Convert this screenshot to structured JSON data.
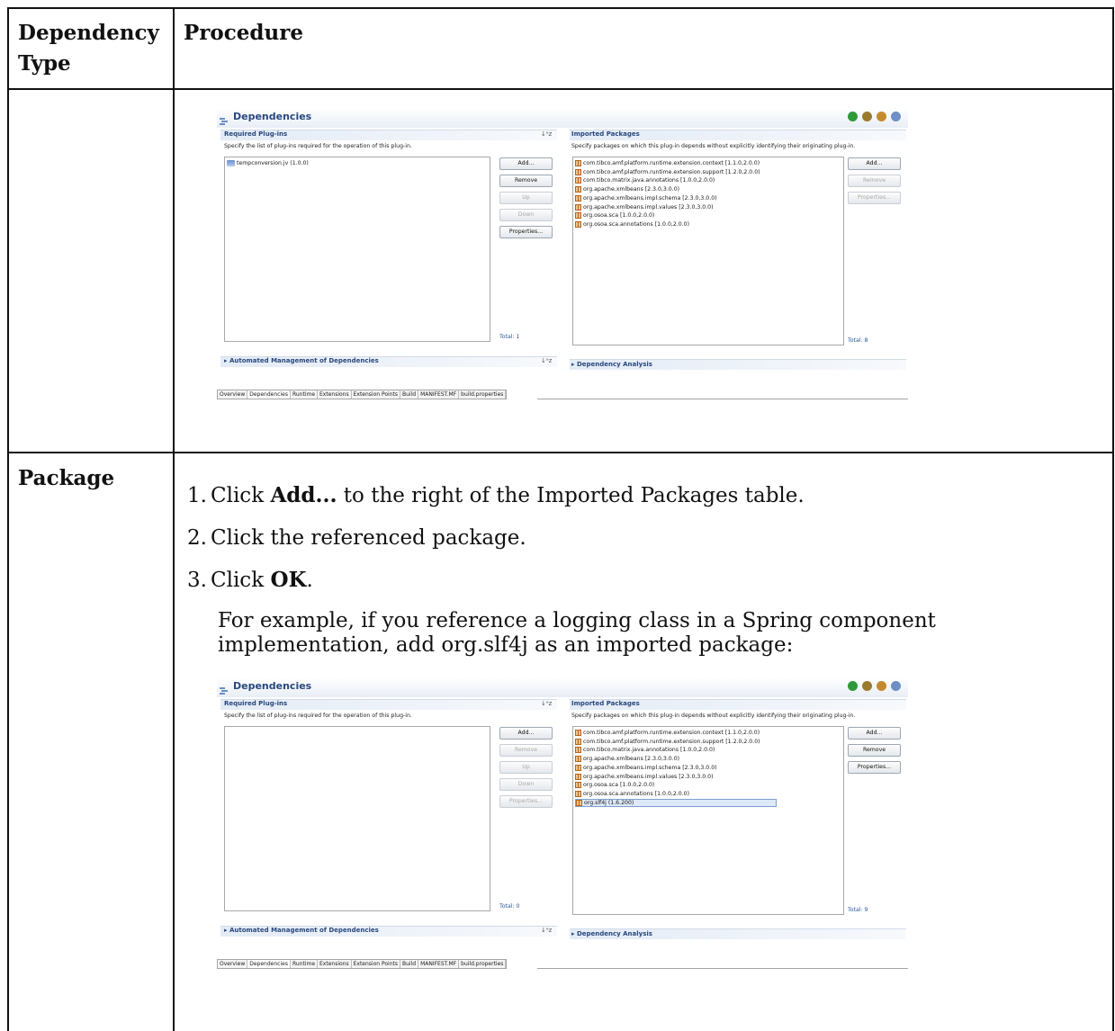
{
  "table": {
    "col1_header": "Dependency Type",
    "col2_header": "Procedure",
    "row2_type": "Package"
  },
  "steps": [
    {
      "num": "1.",
      "pre": "Click ",
      "bold": "Add...",
      "post": " to the right of the Imported Packages table."
    },
    {
      "num": "2.",
      "pre": "Click the referenced package.",
      "bold": "",
      "post": ""
    },
    {
      "num": "3.",
      "pre": "Click ",
      "bold": "OK",
      "post": "."
    }
  ],
  "example_text": "For example, if you reference a logging class in a Spring component implementation, add org.slf4j as an imported package:",
  "screens": [
    {
      "title": "Dependencies",
      "required_title": "Required Plug-ins",
      "required_desc": "Specify the list of plug-ins required for the operation of this plug-in.",
      "plugins": [
        "tempconversion.jv (1.0.0)"
      ],
      "left_buttons": [
        {
          "label": "Add...",
          "enabled": true
        },
        {
          "label": "Remove",
          "enabled": true
        },
        {
          "label": "Up",
          "enabled": false
        },
        {
          "label": "Down",
          "enabled": false
        },
        {
          "label": "Properties...",
          "enabled": true
        }
      ],
      "left_total": "Total: 1",
      "imported_title": "Imported Packages",
      "imported_desc": "Specify packages on which this plug-in depends without explicitly identifying their originating plug-in.",
      "packages": [
        "com.tibco.amf.platform.runtime.extension.context [1.1.0,2.0.0)",
        "com.tibco.amf.platform.runtime.extension.support [1.2.0,2.0.0)",
        "com.tibco.matrix.java.annotations [1.0.0,2.0.0)",
        "org.apache.xmlbeans [2.3.0,3.0.0)",
        "org.apache.xmlbeans.impl.schema [2.3.0,3.0.0)",
        "org.apache.xmlbeans.impl.values [2.3.0,3.0.0)",
        "org.osoa.sca [1.0.0,2.0.0)",
        "org.osoa.sca.annotations [1.0.0,2.0.0)"
      ],
      "right_buttons": [
        {
          "label": "Add...",
          "enabled": true
        },
        {
          "label": "Remove",
          "enabled": false
        },
        {
          "label": "Properties...",
          "enabled": false
        }
      ],
      "right_total": "Total: 8",
      "auto_title": "Automated Management of Dependencies",
      "analysis_title": "Dependency Analysis",
      "tabs": [
        "Overview",
        "Dependencies",
        "Runtime",
        "Extensions",
        "Extension Points",
        "Build",
        "MANIFEST.MF",
        "build.properties"
      ],
      "active_tab": "Dependencies"
    },
    {
      "title": "Dependencies",
      "required_title": "Required Plug-ins",
      "required_desc": "Specify the list of plug-ins required for the operation of this plug-in.",
      "plugins": [],
      "left_buttons": [
        {
          "label": "Add...",
          "enabled": true
        },
        {
          "label": "Remove",
          "enabled": false
        },
        {
          "label": "Up",
          "enabled": false
        },
        {
          "label": "Down",
          "enabled": false
        },
        {
          "label": "Properties...",
          "enabled": false
        }
      ],
      "left_total": "Total: 0",
      "imported_title": "Imported Packages",
      "imported_desc": "Specify packages on which this plug-in depends without explicitly identifying their originating plug-in.",
      "packages": [
        "com.tibco.amf.platform.runtime.extension.context [1.1.0,2.0.0)",
        "com.tibco.amf.platform.runtime.extension.support [1.2.0,2.0.0)",
        "com.tibco.matrix.java.annotations [1.0.0,2.0.0)",
        "org.apache.xmlbeans [2.3.0,3.0.0)",
        "org.apache.xmlbeans.impl.schema [2.3.0,3.0.0)",
        "org.apache.xmlbeans.impl.values [2.3.0,3.0.0)",
        "org.osoa.sca [1.0.0,2.0.0)",
        "org.osoa.sca.annotations [1.0.0,2.0.0)",
        "org.slf4j (1.6.200)"
      ],
      "selected_package_index": 8,
      "right_buttons": [
        {
          "label": "Add...",
          "enabled": true
        },
        {
          "label": "Remove",
          "enabled": true
        },
        {
          "label": "Properties...",
          "enabled": true
        }
      ],
      "right_total": "Total: 9",
      "auto_title": "Automated Management of Dependencies",
      "analysis_title": "Dependency Analysis",
      "tabs": [
        "Overview",
        "Dependencies",
        "Runtime",
        "Extensions",
        "Extension Points",
        "Build",
        "MANIFEST.MF",
        "build.properties"
      ],
      "active_tab": "Dependencies"
    }
  ]
}
